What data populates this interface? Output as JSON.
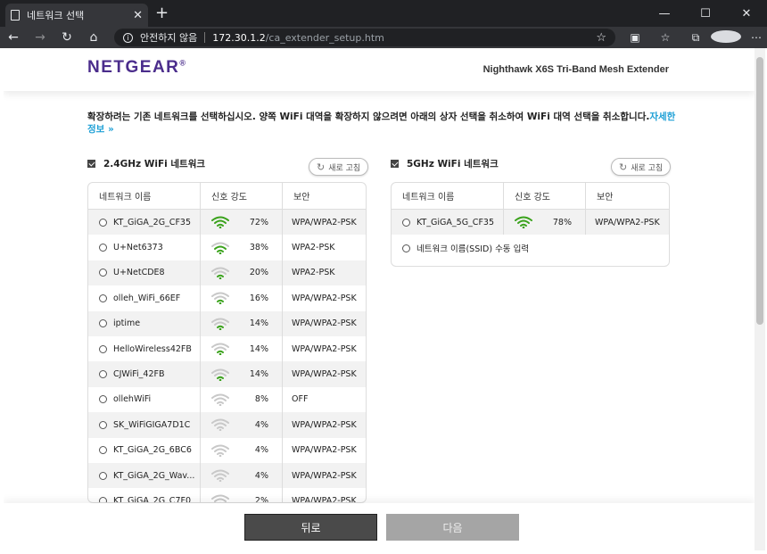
{
  "browser": {
    "tab_title": "네트워크 선택",
    "tab_close": "✕",
    "new_tab": "+",
    "window_controls": [
      "—",
      "☐",
      "✕"
    ],
    "nav": {
      "back": "←",
      "forward": "→",
      "reload": "↻",
      "home": "⌂"
    },
    "security_label": "안전하지 않음",
    "url_host": "172.30.1.2",
    "url_path": "/ca_extender_setup.htm",
    "favorite": "☆",
    "toolbar_icons": [
      "▣",
      "☆",
      "⧉",
      "",
      "⋯"
    ]
  },
  "header": {
    "logo": "NETGEAR",
    "logo_mark": "®",
    "product": "Nighthawk X6S Tri-Band Mesh Extender"
  },
  "instruction": {
    "text": "확장하려는 기존 네트워크를 선택하십시오. 양쪽 WiFi 대역을 확장하지 않으려면 아래의 상자 선택을 취소하여 WiFi 대역 선택을 취소합니다.",
    "link": "자세한 정보 »"
  },
  "band24": {
    "title": "2.4GHz WiFi 네트워크",
    "refresh": "새로 고침",
    "columns": [
      "네트워크 이름",
      "신호 강도",
      "보안"
    ],
    "networks": [
      {
        "ssid": "KT_GiGA_2G_CF35",
        "signal": "72%",
        "security": "WPA/WPA2-PSK",
        "level": 3
      },
      {
        "ssid": "U+Net6373",
        "signal": "38%",
        "security": "WPA2-PSK",
        "level": 2
      },
      {
        "ssid": "U+NetCDE8",
        "signal": "20%",
        "security": "WPA2-PSK",
        "level": 1
      },
      {
        "ssid": "olleh_WiFi_66EF",
        "signal": "16%",
        "security": "WPA/WPA2-PSK",
        "level": 1
      },
      {
        "ssid": "iptime",
        "signal": "14%",
        "security": "WPA/WPA2-PSK",
        "level": 1
      },
      {
        "ssid": "HelloWireless42FB",
        "signal": "14%",
        "security": "WPA/WPA2-PSK",
        "level": 1
      },
      {
        "ssid": "CJWiFi_42FB",
        "signal": "14%",
        "security": "WPA/WPA2-PSK",
        "level": 1
      },
      {
        "ssid": "ollehWiFi",
        "signal": "8%",
        "security": "OFF",
        "level": 0
      },
      {
        "ssid": "SK_WiFiGIGA7D1C",
        "signal": "4%",
        "security": "WPA/WPA2-PSK",
        "level": 0
      },
      {
        "ssid": "KT_GiGA_2G_6BC6",
        "signal": "4%",
        "security": "WPA/WPA2-PSK",
        "level": 0
      },
      {
        "ssid": "KT_GiGA_2G_Wav...",
        "signal": "4%",
        "security": "WPA/WPA2-PSK",
        "level": 0
      },
      {
        "ssid": "KT_GiGA_2G_C7F0",
        "signal": "2%",
        "security": "WPA/WPA2-PSK",
        "level": 0
      }
    ]
  },
  "band5": {
    "title": "5GHz WiFi 네트워크",
    "refresh": "새로 고침",
    "columns": [
      "네트워크 이름",
      "신호 강도",
      "보안"
    ],
    "networks": [
      {
        "ssid": "KT_GiGA_5G_CF35",
        "signal": "78%",
        "security": "WPA/WPA2-PSK",
        "level": 3
      }
    ],
    "manual_entry": "네트워크 이름(SSID) 수동 입력"
  },
  "footer": {
    "back": "뒤로",
    "next": "다음"
  },
  "colors": {
    "brand": "#4b2d8c",
    "signal_green": "#3aa21b",
    "signal_gray": "#c8c8c8",
    "link": "#1ea0d6"
  }
}
